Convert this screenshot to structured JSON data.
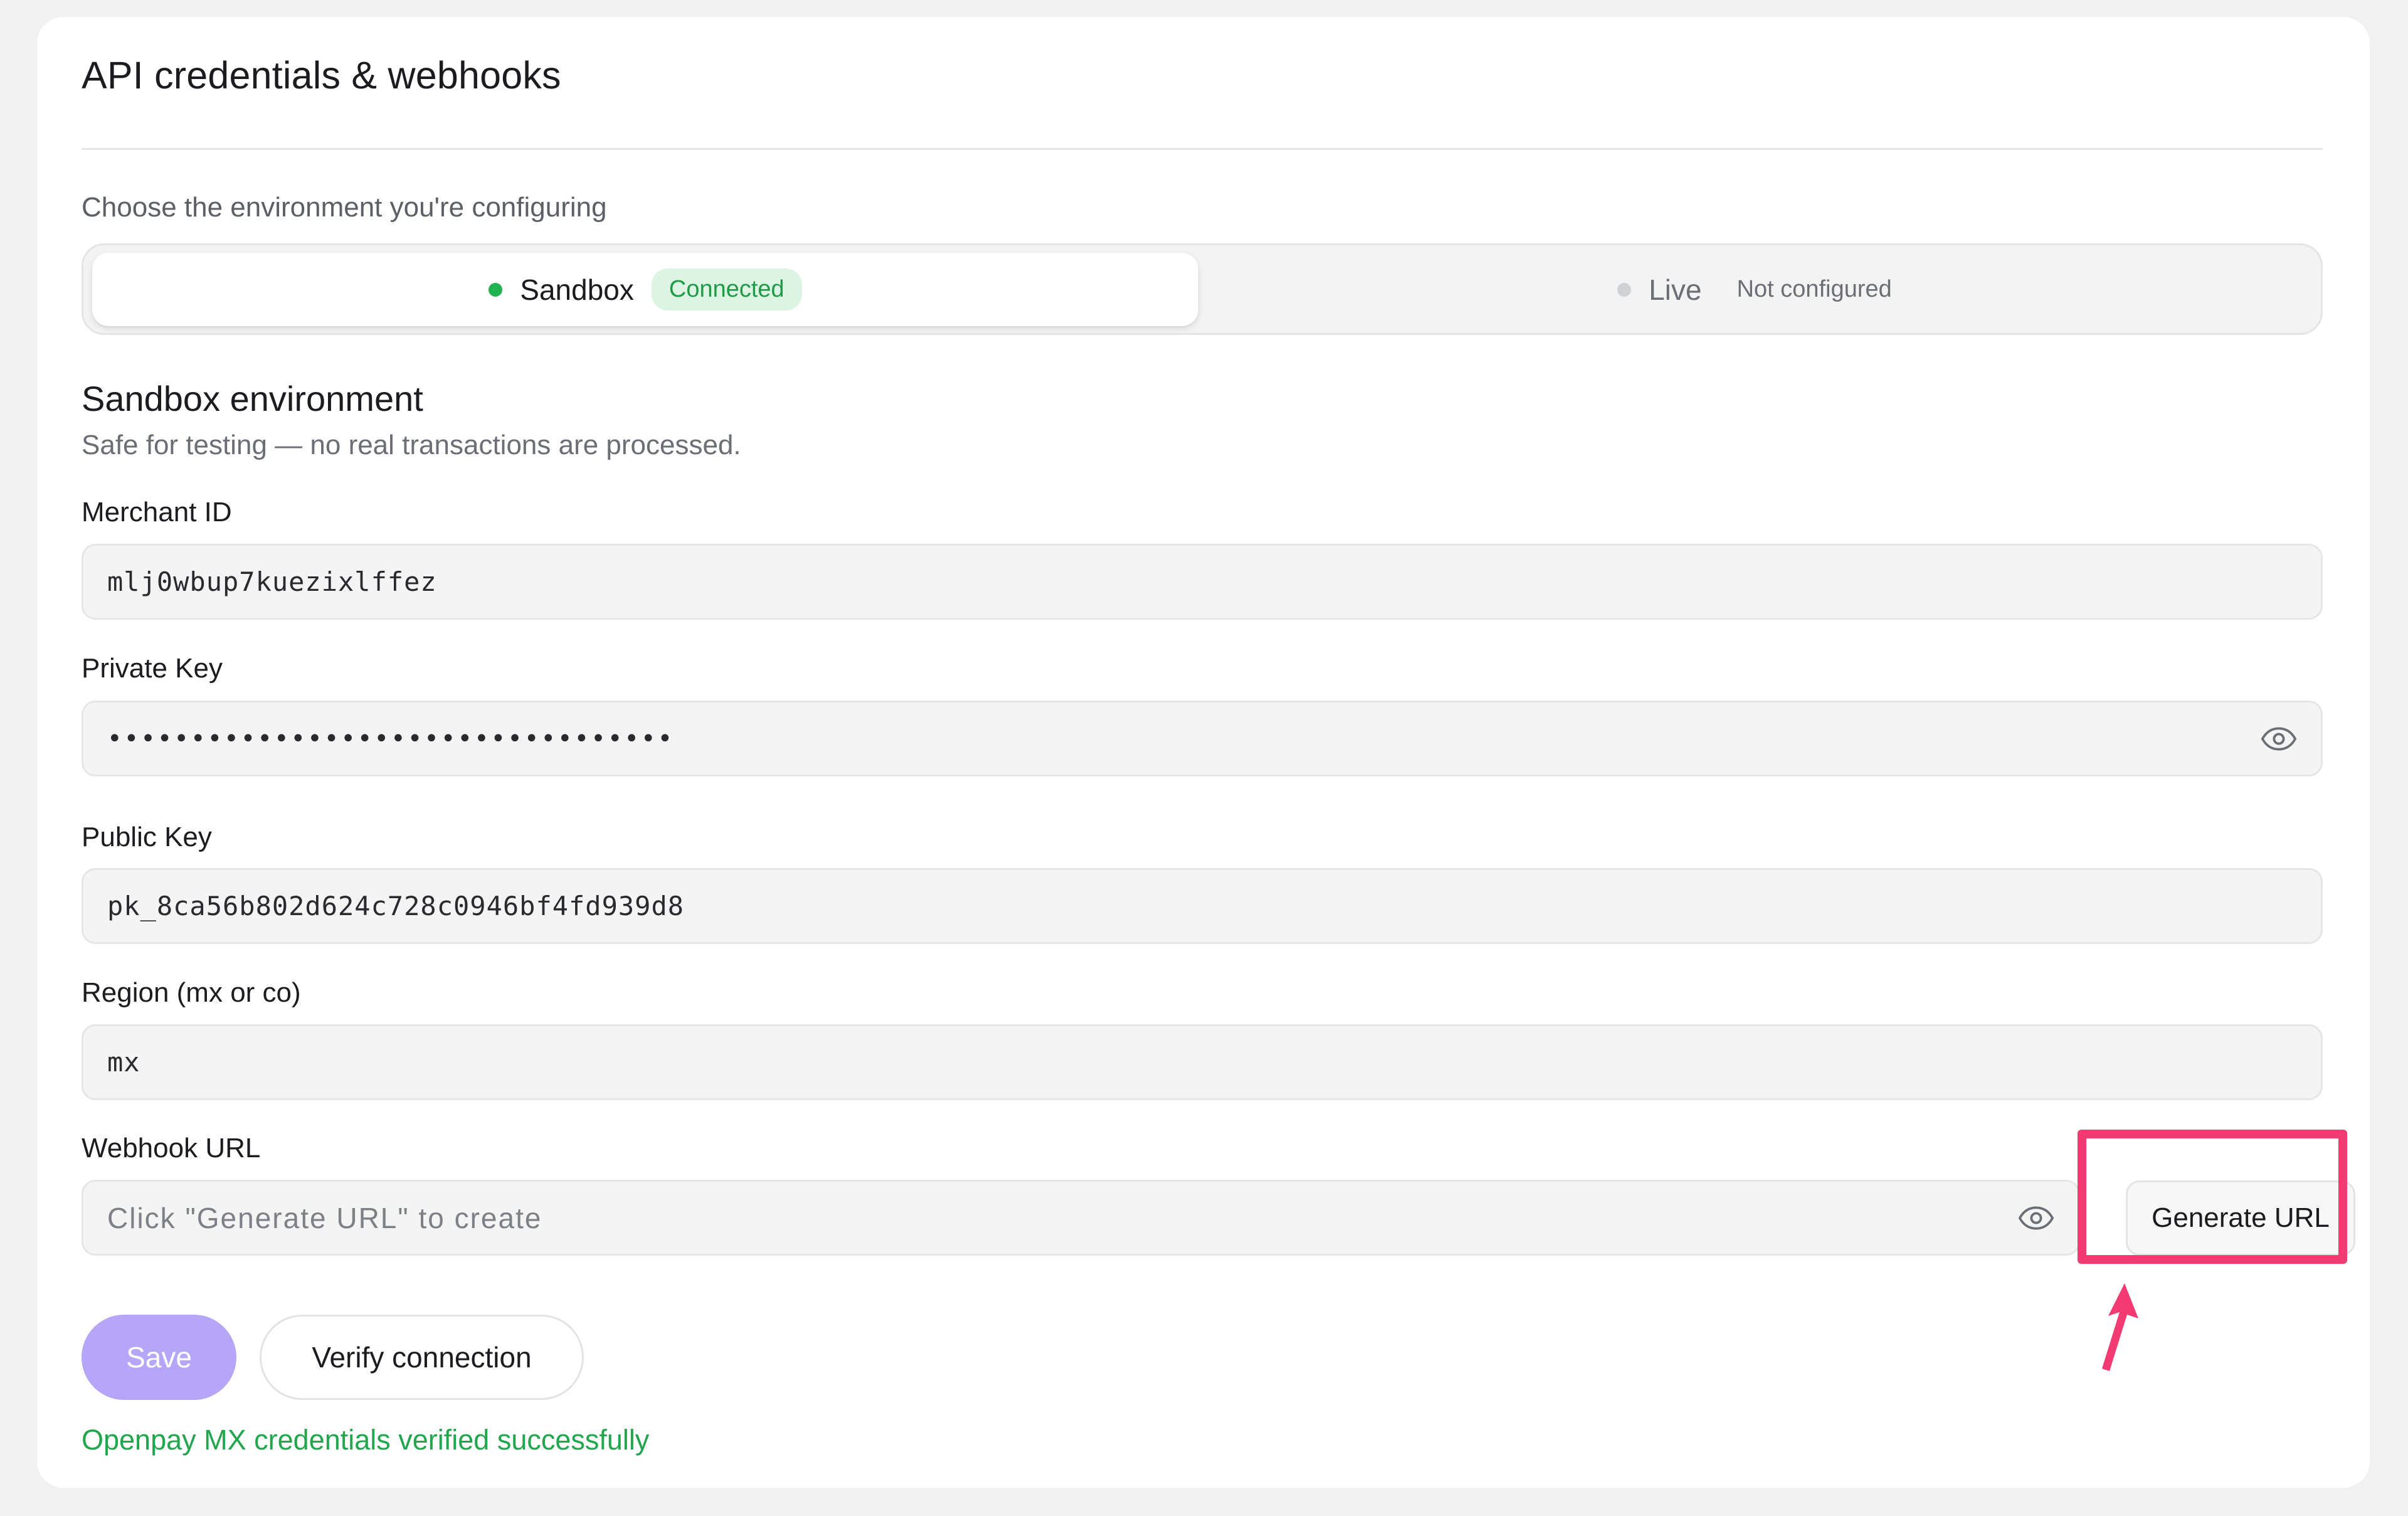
{
  "card": {
    "title": "API credentials & webhooks"
  },
  "environment": {
    "label": "Choose the environment you're configuring",
    "options": [
      {
        "name": "Sandbox",
        "status": "Connected",
        "selected": true,
        "status_color": "#22b351"
      },
      {
        "name": "Live",
        "status": "Not configured",
        "selected": false,
        "status_color": "#cfd1d5"
      }
    ]
  },
  "section": {
    "title": "Sandbox environment",
    "subtitle": "Safe for testing — no real transactions are processed."
  },
  "fields": {
    "merchant_id": {
      "label": "Merchant ID",
      "value": "mlj0wbup7kuezixlffez"
    },
    "private_key": {
      "label": "Private Key",
      "value": "••••••••••••••••••••••••••••••••••",
      "icon": "eye-icon"
    },
    "public_key": {
      "label": "Public Key",
      "value": "pk_8ca56b802d624c728c0946bf4fd939d8"
    },
    "region": {
      "label": "Region (mx or co)",
      "value": "mx"
    },
    "webhook_url": {
      "label": "Webhook URL",
      "placeholder": "Click \"Generate URL\" to create",
      "value": "",
      "icon": "eye-icon"
    }
  },
  "buttons": {
    "generate_url": "Generate URL",
    "save": "Save",
    "verify": "Verify connection"
  },
  "status_message": "Openpay MX credentials verified successfully",
  "colors": {
    "accent": "#b6a6f7",
    "success": "#22a64d",
    "highlight": "#f23b72"
  }
}
